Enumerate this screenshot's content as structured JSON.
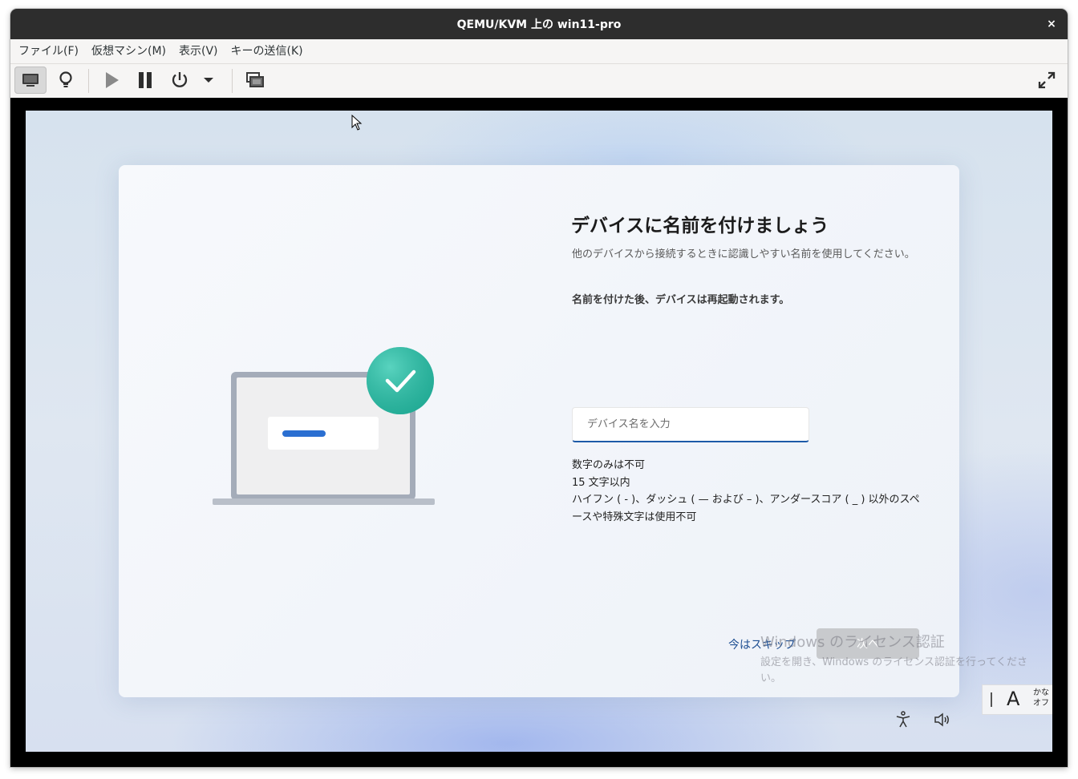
{
  "window": {
    "title": "QEMU/KVM 上の win11-pro",
    "close_label": "×"
  },
  "menubar": {
    "items": [
      "ファイル(F)",
      "仮想マシン(M)",
      "表示(V)",
      "キーの送信(K)"
    ]
  },
  "toolbar": {
    "icons": [
      "monitor-icon",
      "lightbulb-icon",
      "play-icon",
      "pause-icon",
      "power-icon",
      "dropdown-arrow-icon",
      "snapshot-icon",
      "fullscreen-icon"
    ]
  },
  "oobe": {
    "heading": "デバイスに名前を付けましょう",
    "description": "他のデバイスから接続するときに認識しやすい名前を使用してください。",
    "restart_note": "名前を付けた後、デバイスは再起動されます。",
    "input_placeholder": "デバイス名を入力",
    "input_value": "",
    "rules": [
      "数字のみは不可",
      "15 文字以内",
      "ハイフン ( - )、ダッシュ ( — および – )、アンダースコア ( _ ) 以外のスペースや特殊文字は使用不可"
    ],
    "skip_label": "今はスキップ",
    "next_label": "次へ"
  },
  "watermark": {
    "title": "Windows のライセンス認証",
    "body": "設定を開き、Windows のライセンス認証を行ってください。"
  },
  "ime": {
    "mode": "A",
    "kana_line1": "かな",
    "kana_line2": "オフ"
  },
  "colors": {
    "titlebar": "#2d2d2d",
    "accent": "#1d5aa8",
    "check_circle": "#26b59e",
    "laptop_bar": "#2b6fd1"
  }
}
